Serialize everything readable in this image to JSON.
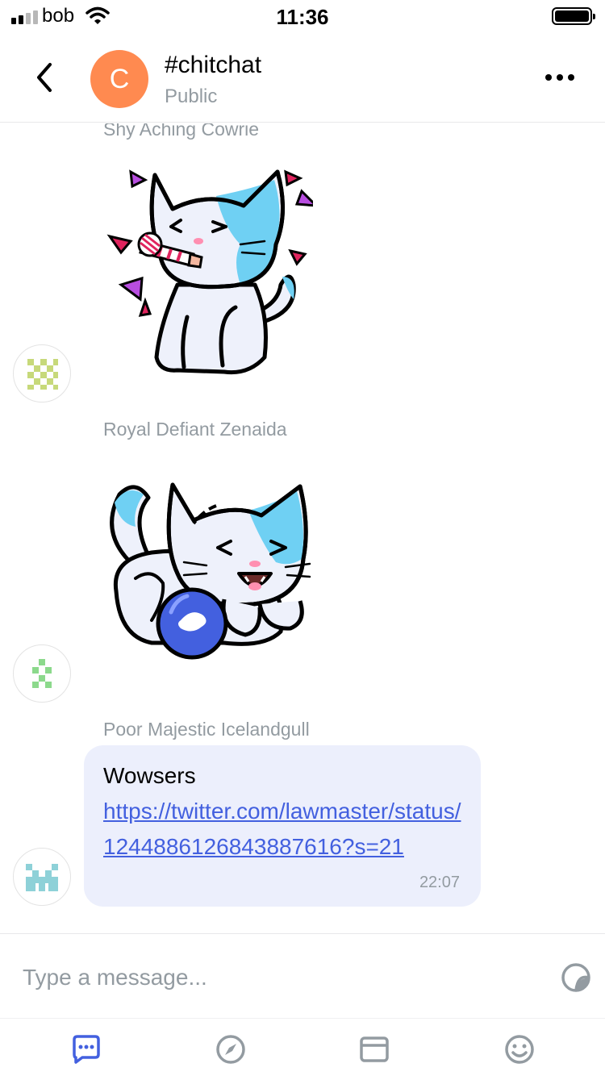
{
  "status_bar": {
    "carrier": "bob",
    "time": "11:36"
  },
  "header": {
    "avatar_letter": "C",
    "avatar_color": "#ff8a50",
    "title": "#chitchat",
    "subtitle": "Public"
  },
  "messages": [
    {
      "sender": "Shy Aching Cowrie",
      "type": "sticker",
      "sticker": "cat-party-blower-sticker"
    },
    {
      "sender": "Royal Defiant Zenaida",
      "type": "sticker",
      "sticker": "cat-with-ball-sticker"
    },
    {
      "sender": "Poor Majestic Icelandgull",
      "type": "text",
      "text": "Wowsers",
      "link": "https://twitter.com/lawmaster/status/1244886126843887616?s=21",
      "time": "22:07"
    }
  ],
  "input": {
    "placeholder": "Type a message..."
  },
  "tabs": [
    {
      "icon": "chat-icon",
      "active": true
    },
    {
      "icon": "compass-icon",
      "active": false
    },
    {
      "icon": "wallet-icon",
      "active": false
    },
    {
      "icon": "profile-smiley-icon",
      "active": false
    }
  ],
  "colors": {
    "accent": "#4360df",
    "bubble": "#eceffc",
    "secondary_text": "#939ba1"
  }
}
